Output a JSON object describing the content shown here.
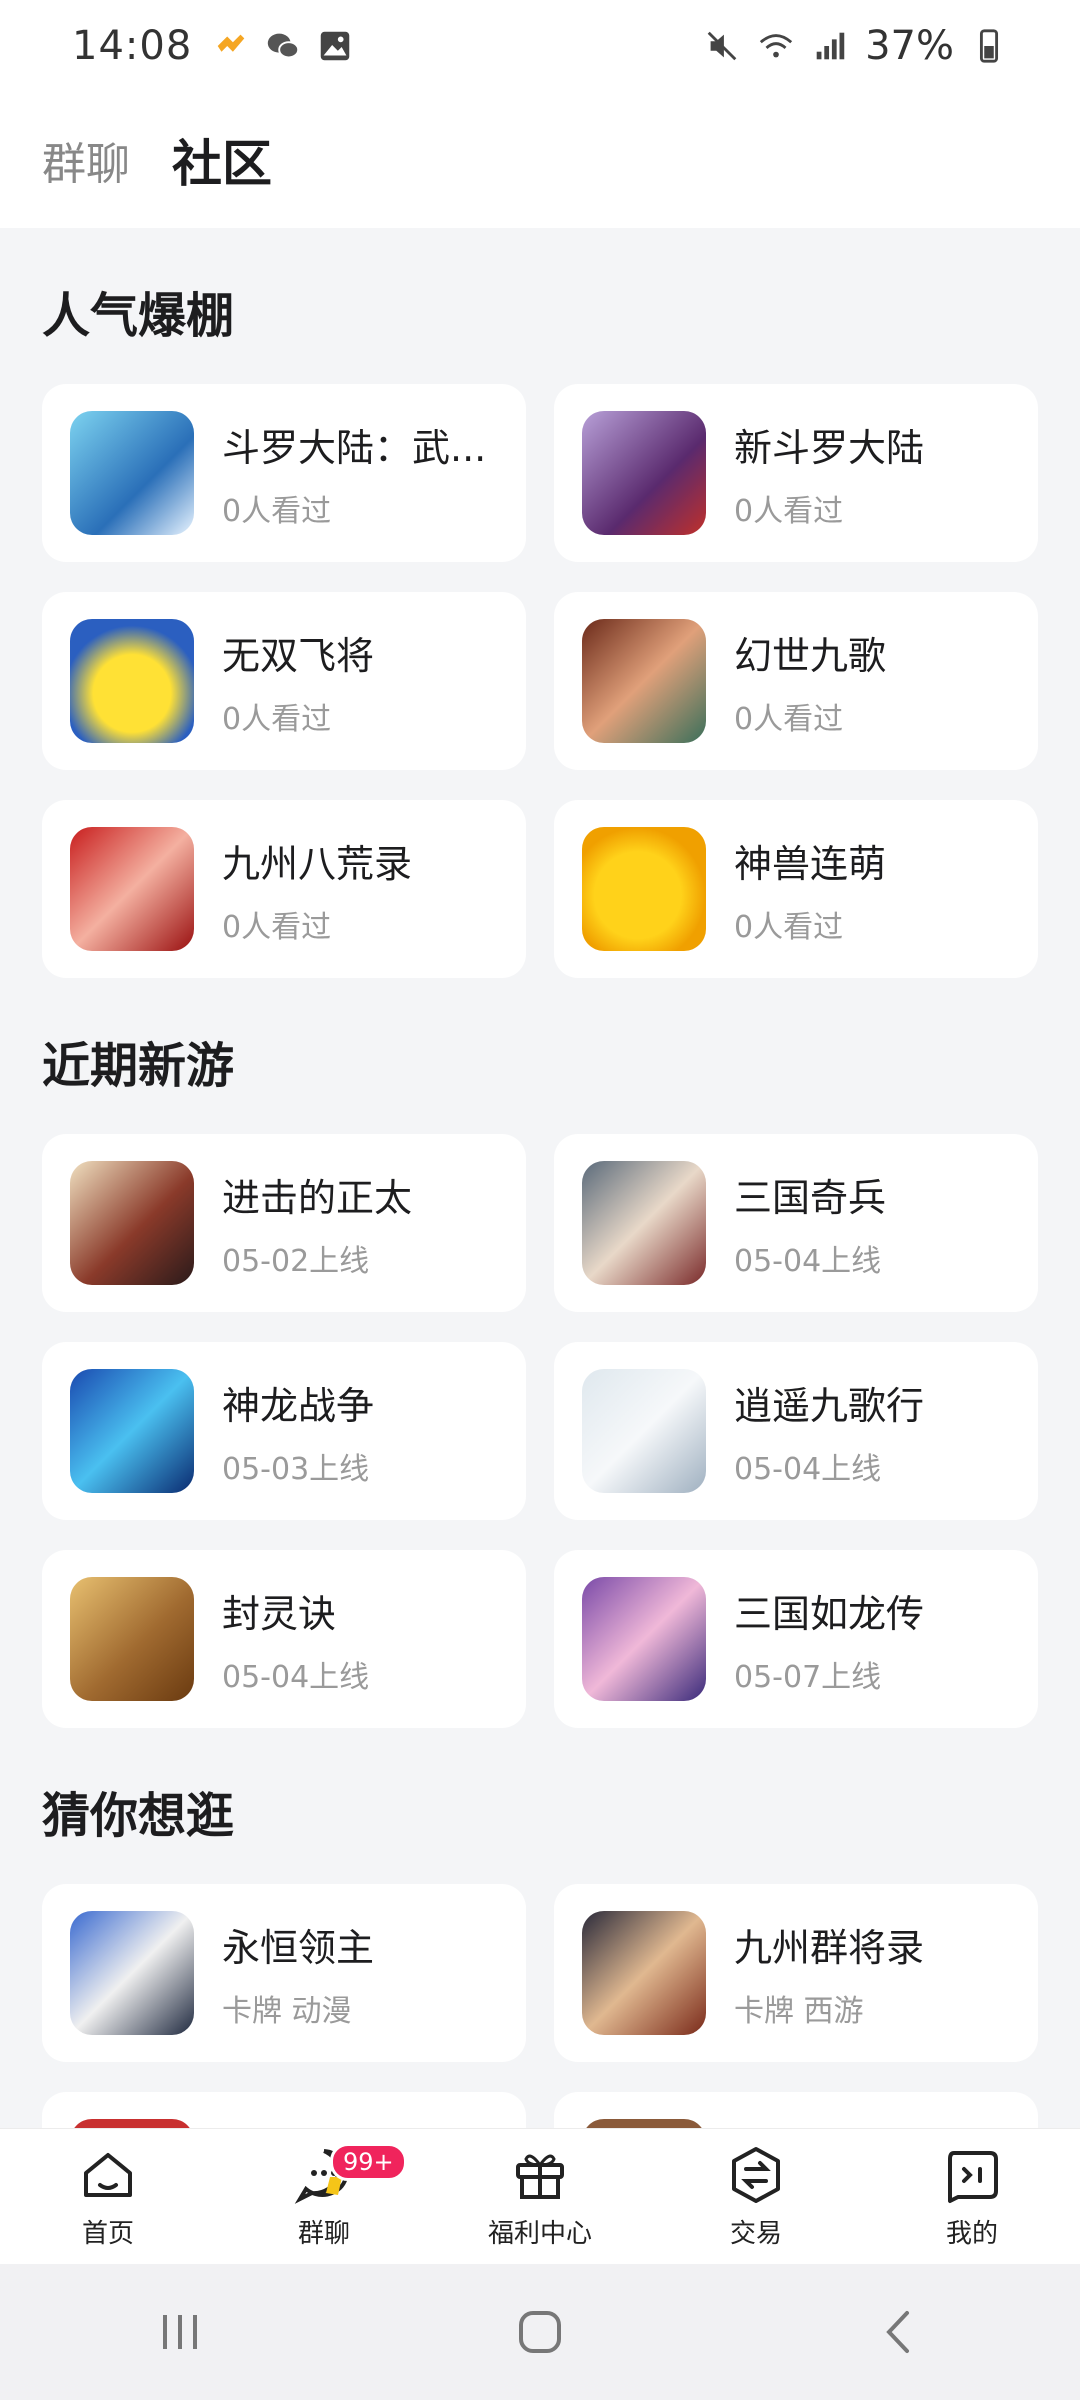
{
  "status_bar": {
    "time": "14:08",
    "battery": "37%",
    "left_icons": [
      "notification-app-icon",
      "wechat-icon",
      "gallery-icon"
    ],
    "right_icons": [
      "mute-icon",
      "wifi-icon",
      "signal-icon",
      "battery-icon"
    ]
  },
  "top_tabs": [
    {
      "label": "群聊",
      "active": false
    },
    {
      "label": "社区",
      "active": true
    }
  ],
  "sections": {
    "popular": {
      "title": "人气爆棚",
      "items": [
        {
          "name": "斗罗大陆：武...",
          "sub": "0人看过"
        },
        {
          "name": "新斗罗大陆",
          "sub": "0人看过"
        },
        {
          "name": "无双飞将",
          "sub": "0人看过"
        },
        {
          "name": "幻世九歌",
          "sub": "0人看过"
        },
        {
          "name": "九州八荒录",
          "sub": "0人看过"
        },
        {
          "name": "神兽连萌",
          "sub": "0人看过"
        }
      ]
    },
    "new_games": {
      "title": "近期新游",
      "items": [
        {
          "name": "进击的正太",
          "sub": "05-02上线"
        },
        {
          "name": "三国奇兵",
          "sub": "05-04上线"
        },
        {
          "name": "神龙战争",
          "sub": "05-03上线"
        },
        {
          "name": "逍遥九歌行",
          "sub": "05-04上线"
        },
        {
          "name": "封灵诀",
          "sub": "05-04上线"
        },
        {
          "name": "三国如龙传",
          "sub": "05-07上线"
        }
      ]
    },
    "guess": {
      "title": "猜你想逛",
      "items": [
        {
          "name": "永恒领主",
          "sub": "卡牌 动漫"
        },
        {
          "name": "九州群将录",
          "sub": "卡牌 西游"
        }
      ]
    }
  },
  "bottom_nav": [
    {
      "label": "首页",
      "icon": "home-icon"
    },
    {
      "label": "群聊",
      "icon": "chat-icon",
      "badge": "99+"
    },
    {
      "label": "福利中心",
      "icon": "gift-icon"
    },
    {
      "label": "交易",
      "icon": "trade-icon"
    },
    {
      "label": "我的",
      "icon": "profile-icon"
    }
  ],
  "colors": {
    "badge": "#f0245c",
    "background": "#f4f5f7",
    "card": "#ffffff"
  }
}
